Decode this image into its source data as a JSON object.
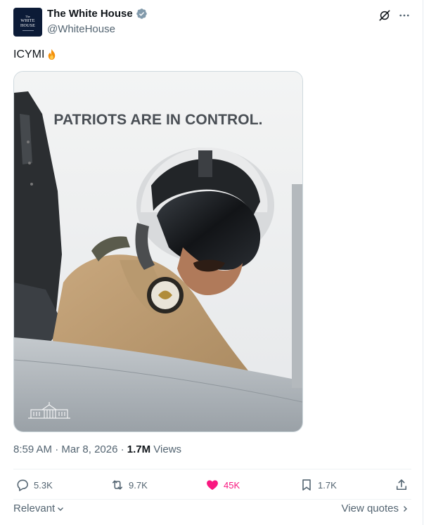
{
  "header": {
    "account_name": "The White House",
    "handle": "@WhiteHouse",
    "avatar_text_top": "The",
    "avatar_text_line1": "WHITE",
    "avatar_text_line2": "HOUSE",
    "icons": [
      "verified-badge-icon",
      "grok-icon",
      "more-icon"
    ]
  },
  "tweet": {
    "text": "ICYMI",
    "emoji": "flame-icon"
  },
  "media": {
    "headline": "PATRIOTS ARE IN CONTROL."
  },
  "meta": {
    "time": "8:59 AM",
    "separator1": " · ",
    "date": "Mar 8, 2026",
    "separator2": " · ",
    "views_count": "1.7M",
    "views_label": " Views"
  },
  "actions": {
    "replies": "5.3K",
    "reposts": "9.7K",
    "likes": "45K",
    "bookmarks": "1.7K"
  },
  "footer": {
    "sort_label": "Relevant",
    "view_quotes": "View quotes"
  },
  "colors": {
    "like_pink": "#f91880",
    "muted_text": "#536471",
    "primary_text": "#0f1419"
  }
}
